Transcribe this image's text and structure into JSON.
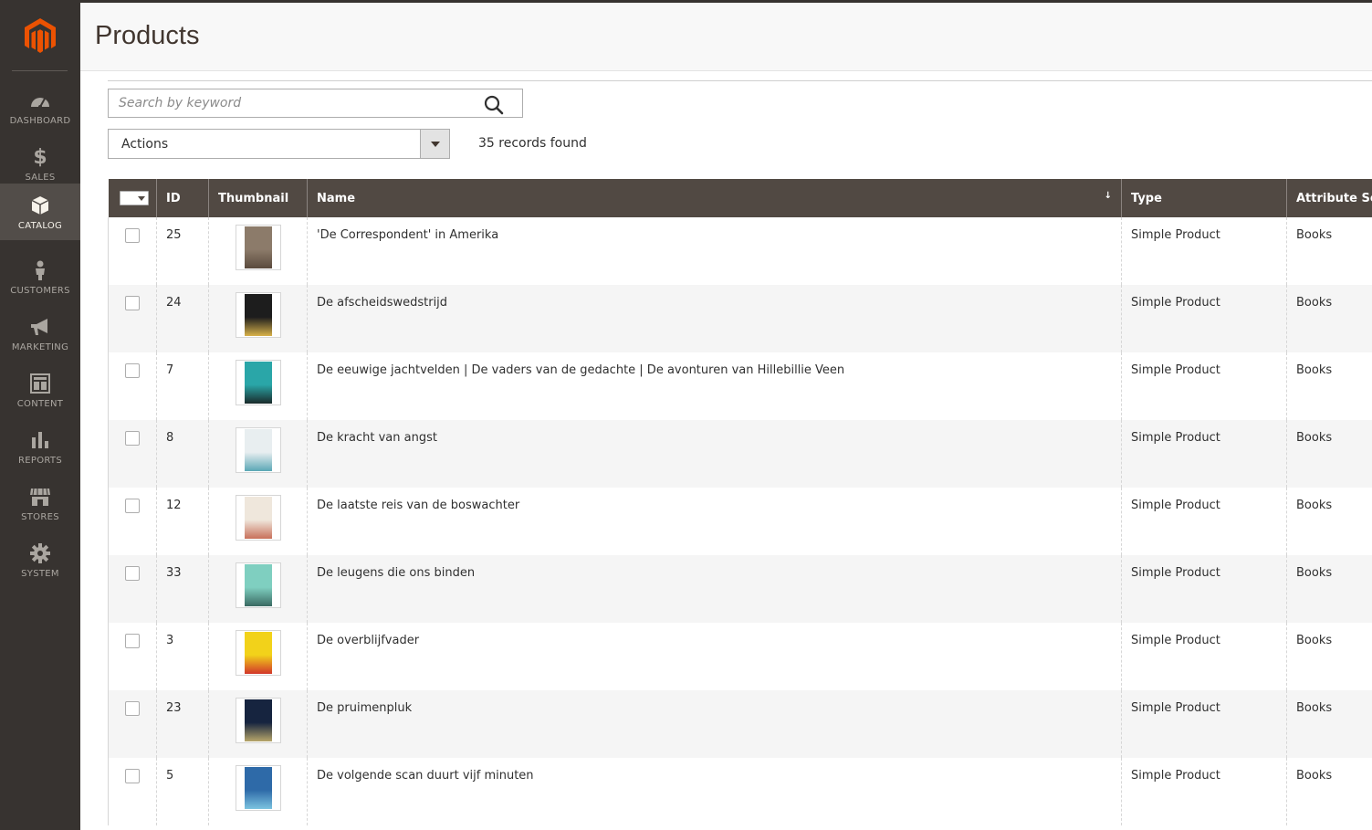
{
  "sidebar": {
    "items": [
      {
        "label": "DASHBOARD",
        "icon": "dashboard-icon"
      },
      {
        "label": "SALES",
        "icon": "dollar-icon"
      },
      {
        "label": "CATALOG",
        "icon": "box-icon",
        "active": true
      },
      {
        "label": "CUSTOMERS",
        "icon": "person-icon"
      },
      {
        "label": "MARKETING",
        "icon": "megaphone-icon"
      },
      {
        "label": "CONTENT",
        "icon": "layout-icon"
      },
      {
        "label": "REPORTS",
        "icon": "bar-chart-icon"
      },
      {
        "label": "STORES",
        "icon": "store-icon"
      },
      {
        "label": "SYSTEM",
        "icon": "gear-icon"
      }
    ]
  },
  "header": {
    "title": "Products"
  },
  "search": {
    "placeholder": "Search by keyword"
  },
  "toolbar": {
    "actions_label": "Actions",
    "records_found": "35 records found"
  },
  "grid": {
    "columns": [
      "ID",
      "Thumbnail",
      "Name",
      "Type",
      "Attribute Set"
    ],
    "rows": [
      {
        "id": "25",
        "name": "'De Correspondent' in Amerika",
        "type": "Simple Product",
        "attribute_set": "Books",
        "cover": [
          "#8c7b6a",
          "#5a4a3d"
        ]
      },
      {
        "id": "24",
        "name": "De afscheidswedstrijd",
        "type": "Simple Product",
        "attribute_set": "Books",
        "cover": [
          "#1d1d1d",
          "#d8b24a"
        ]
      },
      {
        "id": "7",
        "name": "De eeuwige jachtvelden | De vaders van de gedachte | De avonturen van Hillebillie Veen",
        "type": "Simple Product",
        "attribute_set": "Books",
        "cover": [
          "#2aa6a8",
          "#1a2a2a"
        ]
      },
      {
        "id": "8",
        "name": "De kracht van angst",
        "type": "Simple Product",
        "attribute_set": "Books",
        "cover": [
          "#e8eef0",
          "#5aa7b5"
        ]
      },
      {
        "id": "12",
        "name": "De laatste reis van de boswachter",
        "type": "Simple Product",
        "attribute_set": "Books",
        "cover": [
          "#efe7dc",
          "#c8705a"
        ]
      },
      {
        "id": "33",
        "name": "De leugens die ons binden",
        "type": "Simple Product",
        "attribute_set": "Books",
        "cover": [
          "#7fcfc0",
          "#3a6a62"
        ]
      },
      {
        "id": "3",
        "name": "De overblijfvader",
        "type": "Simple Product",
        "attribute_set": "Books",
        "cover": [
          "#f2d21a",
          "#d2362a"
        ]
      },
      {
        "id": "23",
        "name": "De pruimenpluk",
        "type": "Simple Product",
        "attribute_set": "Books",
        "cover": [
          "#16243f",
          "#b7a66a"
        ]
      },
      {
        "id": "5",
        "name": "De volgende scan duurt vijf minuten",
        "type": "Simple Product",
        "attribute_set": "Books",
        "cover": [
          "#2e6aa8",
          "#7cc3e0"
        ]
      }
    ]
  },
  "colors": {
    "sidebar_bg": "#373330",
    "accent": "#eb5202",
    "grid_header": "#514943"
  }
}
